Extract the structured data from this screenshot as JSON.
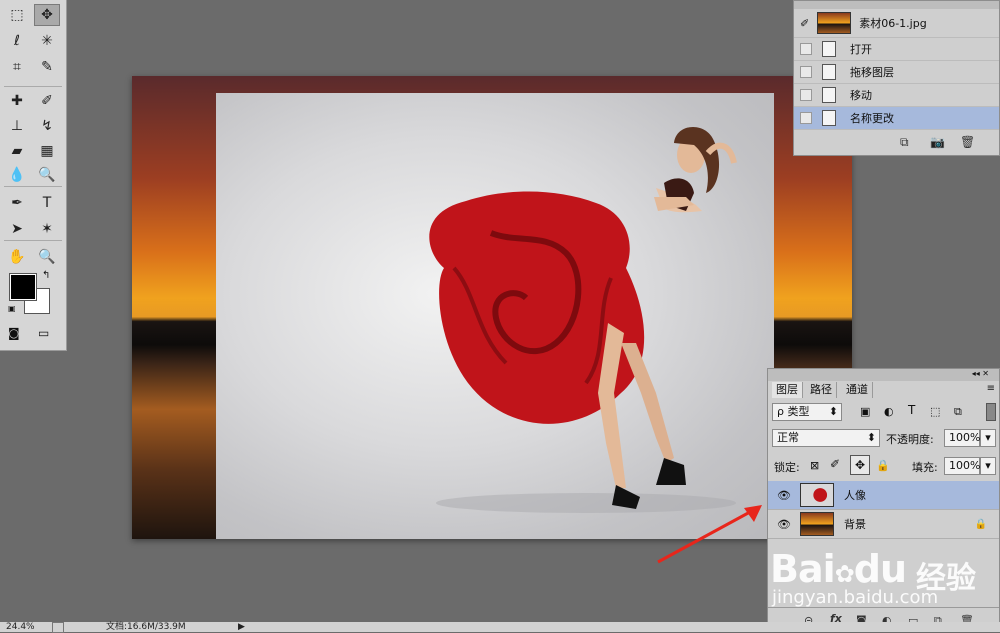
{
  "toolbox": {
    "tools": [
      {
        "name": "rect-marquee-icon",
        "glyph": "⬚"
      },
      {
        "name": "move-icon",
        "glyph": "✥"
      },
      {
        "name": "lasso-icon",
        "glyph": "ℓ"
      },
      {
        "name": "magic-wand-icon",
        "glyph": "✳"
      },
      {
        "name": "crop-icon",
        "glyph": "⌗"
      },
      {
        "name": "eyedropper-icon",
        "glyph": "✎"
      },
      {
        "name": "healing-brush-icon",
        "glyph": "✚"
      },
      {
        "name": "brush-icon",
        "glyph": "✐"
      },
      {
        "name": "clone-stamp-icon",
        "glyph": "⊥"
      },
      {
        "name": "history-brush-icon",
        "glyph": "↯"
      },
      {
        "name": "eraser-icon",
        "glyph": "▰"
      },
      {
        "name": "gradient-icon",
        "glyph": "▦"
      },
      {
        "name": "blur-icon",
        "glyph": "💧"
      },
      {
        "name": "dodge-icon",
        "glyph": "🔍"
      },
      {
        "name": "pen-icon",
        "glyph": "✒"
      },
      {
        "name": "type-icon",
        "glyph": "T"
      },
      {
        "name": "path-select-icon",
        "glyph": "➤"
      },
      {
        "name": "shape-icon",
        "glyph": "✶"
      },
      {
        "name": "hand-icon",
        "glyph": "✋"
      },
      {
        "name": "zoom-icon",
        "glyph": "🔍"
      }
    ],
    "foreground_color": "#000000",
    "background_color": "#ffffff"
  },
  "history": {
    "snapshot_label": "素材06-1.jpg",
    "items": [
      {
        "label": "打开",
        "selected": false
      },
      {
        "label": "拖移图层",
        "selected": false
      },
      {
        "label": "移动",
        "selected": false
      },
      {
        "label": "名称更改",
        "selected": true
      }
    ]
  },
  "layers": {
    "tabs": [
      "图层",
      "路径",
      "通道"
    ],
    "filter_label": "ρ 类型",
    "blend_mode": "正常",
    "opacity_label": "不透明度:",
    "opacity_value": "100%",
    "lock_label": "锁定:",
    "fill_label": "填充:",
    "fill_value": "100%",
    "items": [
      {
        "name": "人像",
        "selected": true
      },
      {
        "name": "背景",
        "selected": false
      }
    ]
  },
  "status": {
    "zoom": "24.4%",
    "doc_info": "文档:16.6M/33.9M"
  },
  "watermark": {
    "brand": "Bai",
    "brand_suffix": "du",
    "brand_cn": "经验",
    "url": "jingyan.baidu.com"
  },
  "colors": {
    "accent_selection": "#a6b9dc",
    "arrow": "#e8261b"
  }
}
